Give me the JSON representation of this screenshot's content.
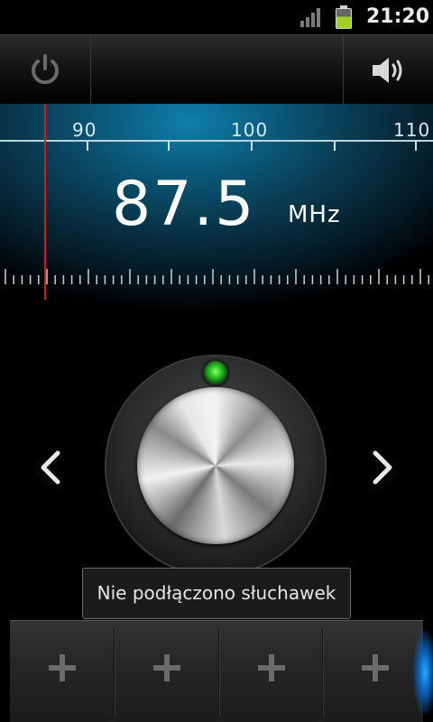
{
  "status_bar": {
    "time": "21:20",
    "battery_level": 0.6,
    "colors": {
      "battery": "#9ed121"
    }
  },
  "top_bar": {
    "power_icon": "power-icon",
    "speaker_icon": "speaker-icon"
  },
  "tuner": {
    "scale_labels": [
      "90",
      "100",
      "110"
    ],
    "frequency": "87.5",
    "unit": "MHz",
    "colors": {
      "needle": "#e0121c",
      "glow": "#0f7eab"
    }
  },
  "knob": {
    "indicator_color": "#29c023",
    "prev_icon": "chevron-left-icon",
    "next_icon": "chevron-right-icon"
  },
  "toast": {
    "message": "Nie podłączono słuchawek"
  },
  "presets": {
    "slots": [
      {
        "icon": "plus-icon"
      },
      {
        "icon": "plus-icon"
      },
      {
        "icon": "plus-icon"
      },
      {
        "icon": "plus-icon"
      }
    ]
  }
}
